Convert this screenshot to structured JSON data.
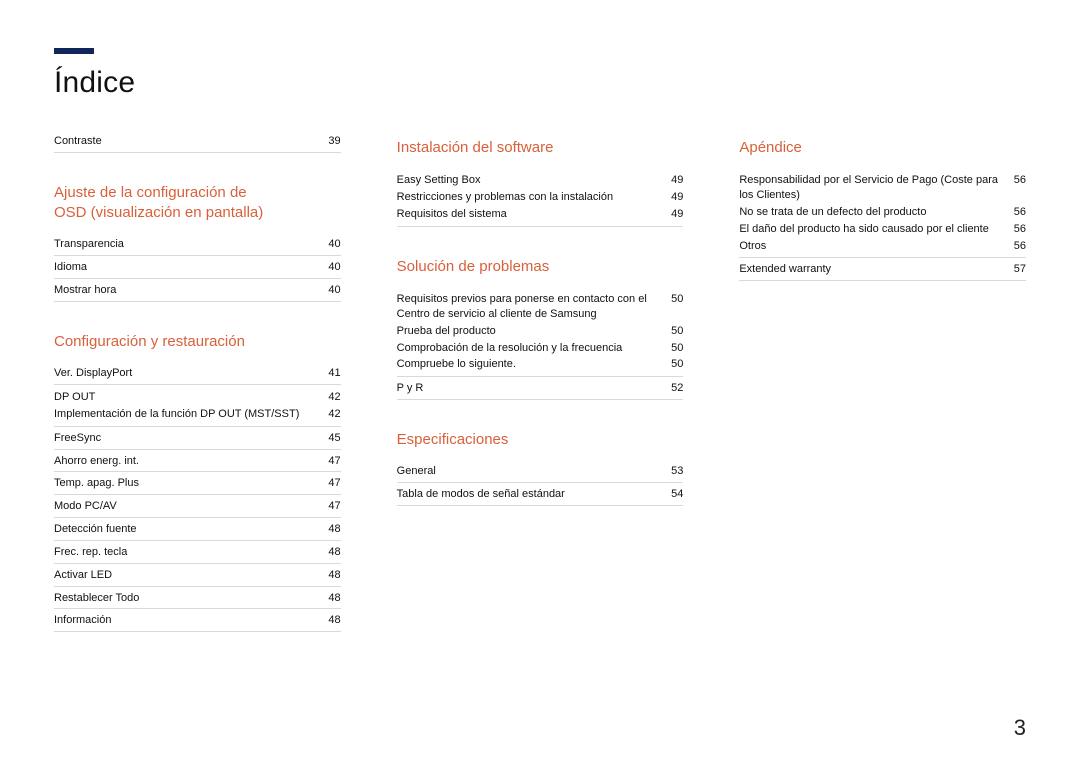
{
  "title": "Índice",
  "page_number": "3",
  "col1": {
    "pre_block": {
      "items": [
        {
          "label": "Contraste",
          "page": "39"
        }
      ]
    },
    "sec1": {
      "heading_line1": "Ajuste de la configuración de",
      "heading_line2": "OSD (visualización en pantalla)",
      "items": [
        {
          "label": "Transparencia",
          "page": "40"
        },
        {
          "label": "Idioma",
          "page": "40"
        },
        {
          "label": "Mostrar hora",
          "page": "40"
        }
      ]
    },
    "sec2": {
      "heading": "Configuración y restauración",
      "items": [
        {
          "label": "Ver. DisplayPort",
          "page": "41"
        },
        {
          "label": "DP OUT",
          "page": "42",
          "subs": [
            {
              "label": "Implementación de la función DP OUT (MST/SST)",
              "page": "42"
            }
          ]
        },
        {
          "label": "FreeSync",
          "page": "45"
        },
        {
          "label": "Ahorro energ. int.",
          "page": "47"
        },
        {
          "label": "Temp. apag. Plus",
          "page": "47"
        },
        {
          "label": "Modo PC/AV",
          "page": "47"
        },
        {
          "label": "Detección fuente",
          "page": "48"
        },
        {
          "label": "Frec. rep. tecla",
          "page": "48"
        },
        {
          "label": "Activar LED",
          "page": "48"
        },
        {
          "label": "Restablecer Todo",
          "page": "48"
        },
        {
          "label": "Información",
          "page": "48"
        }
      ]
    }
  },
  "col2": {
    "sec1": {
      "heading": "Instalación del software",
      "groupHead": {
        "label": "Easy Setting Box",
        "page": "49"
      },
      "groupSubs": [
        {
          "label": "Restricciones y problemas con la instalación",
          "page": "49"
        },
        {
          "label": "Requisitos del sistema",
          "page": "49"
        }
      ]
    },
    "sec2": {
      "heading": "Solución de problemas",
      "group": {
        "label": "Requisitos previos para ponerse en contacto con el Centro de servicio al cliente de Samsung",
        "page": "50"
      },
      "groupSubs": [
        {
          "label": "Prueba del producto",
          "page": "50"
        },
        {
          "label": "Comprobación de la resolución y la frecuencia",
          "page": "50"
        },
        {
          "label": "Compruebe lo siguiente.",
          "page": "50"
        }
      ],
      "after": [
        {
          "label": "P y R",
          "page": "52"
        }
      ]
    },
    "sec3": {
      "heading": "Especificaciones",
      "items": [
        {
          "label": "General",
          "page": "53"
        },
        {
          "label": "Tabla de modos de señal estándar",
          "page": "54"
        }
      ]
    }
  },
  "col3": {
    "sec1": {
      "heading": "Apéndice",
      "group": {
        "label": "Responsabilidad por el Servicio de Pago (Coste para los Clientes)",
        "page": "56"
      },
      "groupSubs": [
        {
          "label": "No se trata de un defecto del producto",
          "page": "56"
        },
        {
          "label": "El daño del producto ha sido causado por el cliente",
          "page": "56"
        },
        {
          "label": "Otros",
          "page": "56"
        }
      ],
      "after": [
        {
          "label": "Extended warranty",
          "page": "57"
        }
      ]
    }
  }
}
